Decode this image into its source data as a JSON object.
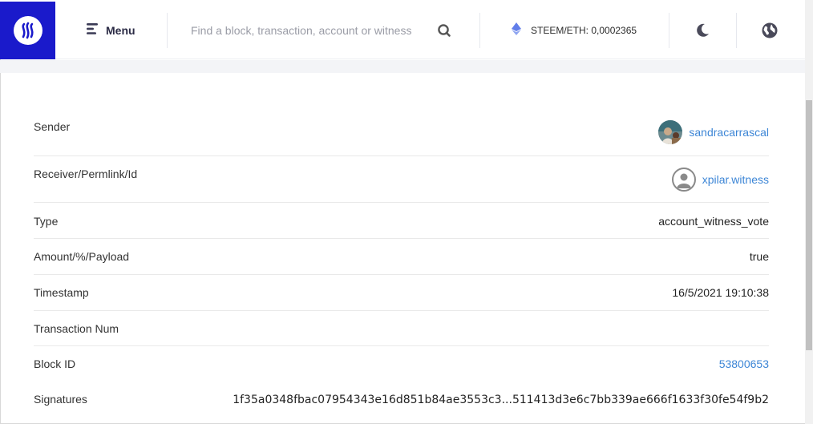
{
  "header": {
    "menu_label": "Menu",
    "search_placeholder": "Find a block, transaction, account or witness",
    "price_text": "STEEM/ETH: 0,0002365"
  },
  "details": {
    "rows": [
      {
        "key": "Sender",
        "value": "sandracarrascal"
      },
      {
        "key": "Receiver/Permlink/Id",
        "value": "xpilar.witness"
      },
      {
        "key": "Type",
        "value": "account_witness_vote"
      },
      {
        "key": "Amount/%/Payload",
        "value": "true"
      },
      {
        "key": "Timestamp",
        "value": "16/5/2021 19:10:38"
      },
      {
        "key": "Transaction Num",
        "value": ""
      },
      {
        "key": "Block ID",
        "value": "53800653"
      },
      {
        "key": "Signatures",
        "value": "1f35a0348fbac07954343e16d851b84ae3553c3...511413d3e6c7bb339ae666f1633f30fe54f9b2"
      }
    ]
  },
  "colors": {
    "brand": "#1a1acb",
    "link": "#3d86d6",
    "ethereum": "#627eea"
  },
  "icons": {
    "logo": "steem-logo-icon",
    "menu": "menu-lines-icon",
    "search": "search-icon",
    "price": "ethereum-icon",
    "theme": "moon-icon",
    "language": "globe-icon"
  }
}
